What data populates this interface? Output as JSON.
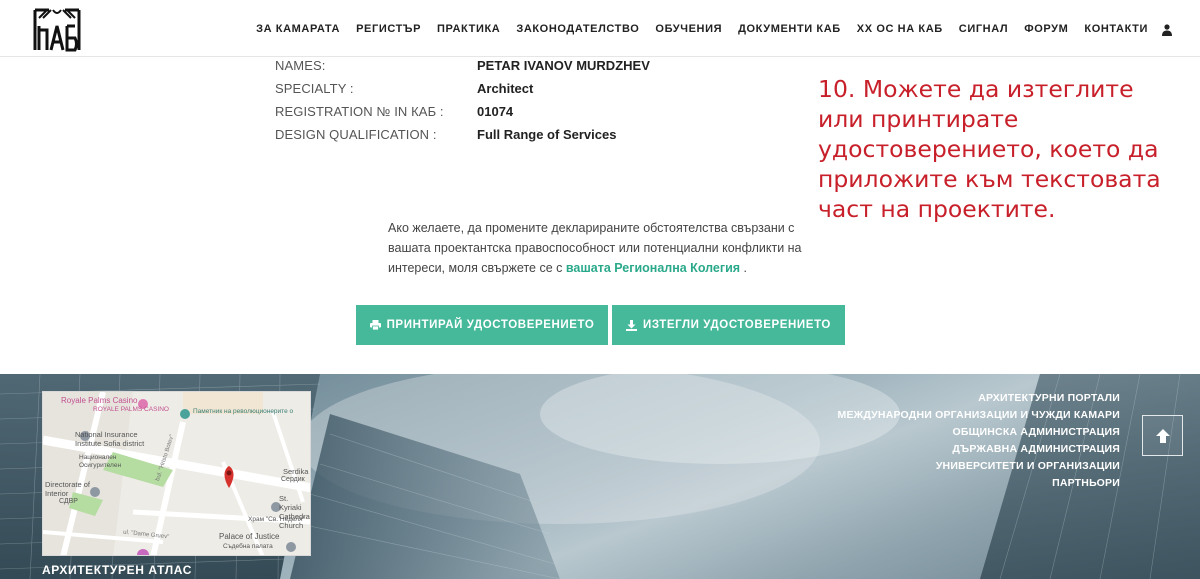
{
  "nav": {
    "items": [
      "ЗА КАМАРАТА",
      "РЕГИСТЪР",
      "ПРАКТИКА",
      "ЗАКОНОДАТЕЛСТВО",
      "ОБУЧЕНИЯ",
      "ДОКУМЕНТИ КАБ",
      "XX ОС НА КАБ",
      "СИГНАЛ",
      "ФОРУМ",
      "КОНТАКТИ"
    ],
    "user_icon": "user-icon",
    "logo_icon": "kab-logo"
  },
  "details": [
    {
      "label": "NAMES:",
      "value": "PETAR IVANOV MURDZHEV"
    },
    {
      "label": "SPECIALTY :",
      "value": "Architect"
    },
    {
      "label": "REGISTRATION № IN КАБ :",
      "value": "01074"
    },
    {
      "label": "DESIGN QUALIFICATION :",
      "value": "Full Range of Services"
    }
  ],
  "annotation": {
    "text": "10. Можете да изтеглите или принтирате удостоверението, което да приложите към текстовата част на проектите.",
    "color": "#c8202a"
  },
  "note": {
    "text": "Ако желаете, да промените декларираните обстоятелства свързани с вашата проектантска правоспособност или потенциални конфликти на интереси, моля свържете се с",
    "link": "вашата Регионална Колегия",
    "tail": "."
  },
  "buttons": {
    "print": {
      "label": "ПРИНТИРАЙ УДОСТОВЕРЕНИЕТО",
      "icon": "print-icon"
    },
    "download": {
      "label": "ИЗТЕГЛИ УДОСТОВЕРЕНИЕТО",
      "icon": "download-icon"
    },
    "color": "#46b99b"
  },
  "map": {
    "labels": [
      "Royale Palms Casino",
      "ROYALE PALMS CASINO",
      "Паметник на революционерите от...",
      "National Insurance Institute Sofia district",
      "Национален Осигурителен",
      "Serdika",
      "Сердик",
      "Directorate of Interior",
      "СДВР",
      "St. Kyriaki Cathedral Church",
      "Храм \"Св. Неделя\"",
      "Palace of Justice",
      "Съдебна палата",
      "bul. \"Hristo Botev\"",
      "ul. \"Dame Gruev\""
    ]
  },
  "footer": {
    "atlas": "АРХИТЕКТУРЕН АТЛАС",
    "links": [
      "АРХИТЕКТУРНИ ПОРТАЛИ",
      "МЕЖДУНАРОДНИ ОРГАНИЗАЦИИ И ЧУЖДИ КАМАРИ",
      "ОБЩИНСКА АДМИНИСТРАЦИЯ",
      "ДЪРЖАВНА АДМИНИСТРАЦИЯ",
      "УНИВЕРСИТЕТИ И ОРГАНИЗАЦИИ",
      "ПАРТНЬОРИ"
    ],
    "back_to_top_icon": "arrow-up-icon"
  }
}
